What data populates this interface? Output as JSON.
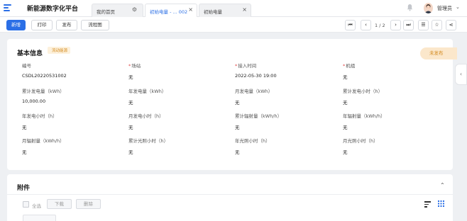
{
  "app": {
    "title": "新能源数字化平台"
  },
  "tabs": [
    {
      "label": "我的首页"
    },
    {
      "label": "初始电量 - ... 002"
    },
    {
      "label": "初始电量"
    }
  ],
  "user": {
    "name": "管理员"
  },
  "toolbar": {
    "add": "新增",
    "print": "打印",
    "publish": "发布",
    "flowchart": "流程图"
  },
  "pager": {
    "text": "1 / 2"
  },
  "basic": {
    "title": "基本信息",
    "tag": "流动能源",
    "status": "未发布",
    "fields": [
      {
        "label": "编号",
        "value": "CSDL20220531002",
        "required": false
      },
      {
        "label": "场站",
        "value": "无",
        "required": true
      },
      {
        "label": "接入时间",
        "value": "2022-05-30 19:00",
        "required": true
      },
      {
        "label": "机组",
        "value": "无",
        "required": true
      },
      {
        "label": "累计发电量（kWh）",
        "value": "10,000.00",
        "required": false
      },
      {
        "label": "年发电量（kWh）",
        "value": "无",
        "required": false
      },
      {
        "label": "月发电量（kWh）",
        "value": "无",
        "required": false
      },
      {
        "label": "累计发电小时（h）",
        "value": "无",
        "required": false
      },
      {
        "label": "年发电小时（h）",
        "value": "无",
        "required": false
      },
      {
        "label": "月发电小时（h）",
        "value": "无",
        "required": false
      },
      {
        "label": "累计辐射量（kWh/h）",
        "value": "无",
        "required": false
      },
      {
        "label": "年辐射量（kWh/h）",
        "value": "无",
        "required": false
      },
      {
        "label": "月辐射量（kWh/h）",
        "value": "无",
        "required": false
      },
      {
        "label": "累计光照小时（h）",
        "value": "无",
        "required": false
      },
      {
        "label": "年光照小时（h）",
        "value": "无",
        "required": false
      },
      {
        "label": "月光照小时（h）",
        "value": "无",
        "required": false
      }
    ]
  },
  "attachments": {
    "title": "附件",
    "select_all": "全选",
    "download": "下载",
    "delete": "删除"
  },
  "colors": {
    "primary": "#2b6fe6",
    "status": "#d38a1e",
    "required": "#e04848"
  }
}
